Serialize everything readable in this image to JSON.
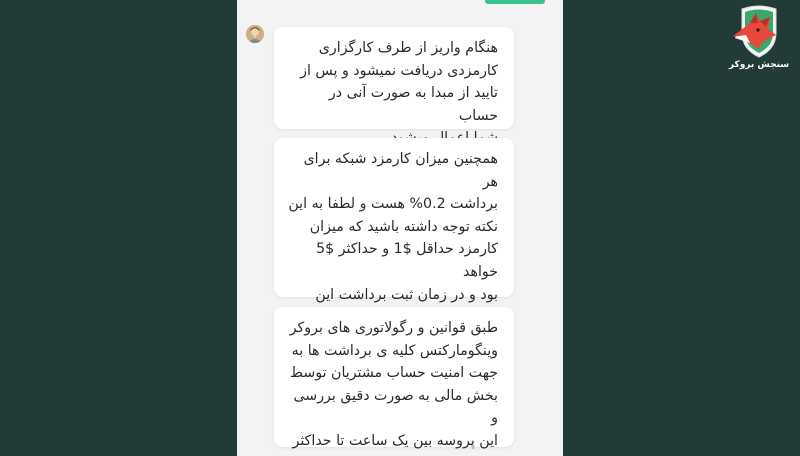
{
  "brand": {
    "name": "سنجش بروکر",
    "colors": {
      "primary": "#e8473b",
      "accent": "#39c28c",
      "background": "#223b36"
    }
  },
  "chat": {
    "agent_avatar_icon": "agent-avatar",
    "messages": [
      {
        "text": "هنگام واریز از طرف کارگزاری\nکارمزدی دریافت نمیشود و پس از\nتایید از مبدا به صورت آنی در حساب\nشما اعمال میشود"
      },
      {
        "text": "همچنین میزان کارمزد شبکه برای هر\nبرداشت 0.2% هست و لطفا به این\nنکته توجه داشته باشید که میزان\nکارمزد حداقل $1 و حداکثر $5 خواهد\nبود و در زمان ثبت برداشت این\nمیزان توسط سیستم محاسبه و به\nشما نمایش داده میشود"
      },
      {
        "text": "طبق قوانین و رگولاتوری های بروکر\nوینگومارکتس کلیه ی برداشت ها به\nجهت امنیت حساب مشتریان توسط\nبخش مالی به صورت دقیق بررسی و\nاین پروسه بین یک ساعت تا حداکثر\nیک روز کاری زمان بر است"
      }
    ]
  }
}
